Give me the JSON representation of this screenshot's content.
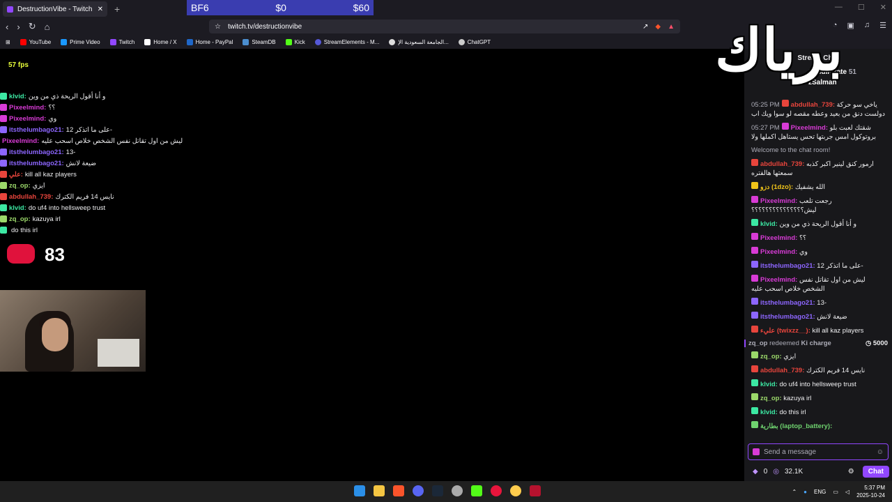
{
  "browser": {
    "tab_title": "DestructionVibe - Twitch",
    "url": "twitch.tv/destructionvibe",
    "bookmarks": [
      "YouTube",
      "Prime Video",
      "Twitch",
      "Home / X",
      "Home - PayPal",
      "SteamDB",
      "Kick",
      "StreamElements - M...",
      "الجامعة السعودية الإ...",
      "ChatGPT"
    ]
  },
  "ad_banner": {
    "title": "BF6",
    "price1": "$0",
    "price2": "$60"
  },
  "stream": {
    "fps": "57",
    "fps_unit": "fps",
    "overlay_title": "برياك",
    "counter": "83"
  },
  "overlay_chat": [
    {
      "name": "klvid",
      "color": "#3ce8a3",
      "text": "و أنا أقول الريحة ذي من وين"
    },
    {
      "name": "Pixeelmind",
      "color": "#d83bd6",
      "text": "؟؟"
    },
    {
      "name": "Pixeelmind",
      "color": "#d83bd6",
      "text": "وي"
    },
    {
      "name": "itsthelumbago21",
      "color": "#8d66ff",
      "text": "على ما اتذكر 12-"
    },
    {
      "name": "Pixeelmind",
      "color": "#d83bd6",
      "text": "ليش من اول تقاتل نفس الشخص خلاص اسحب عليه"
    },
    {
      "name": "itsthelumbago21",
      "color": "#8d66ff",
      "text": "13-"
    },
    {
      "name": "itsthelumbago21",
      "color": "#8d66ff",
      "text": "ضيعة لانش"
    },
    {
      "name": "علي",
      "color": "#e8453c",
      "text": "kill all kaz players"
    },
    {
      "name": "zq_op",
      "color": "#9bd86a",
      "text": "ايزي"
    },
    {
      "name": "abdullah_739",
      "color": "#e8453c",
      "text": "نايس 14 فريم الكترك"
    },
    {
      "name": "klvid",
      "color": "#3ce8a3",
      "text": "do uf4 into hellsweep trust"
    },
    {
      "name": "zq_op",
      "color": "#9bd86a",
      "text": "kazuya irl"
    },
    {
      "name": "",
      "color": "#3ce8a3",
      "text": "do this irl"
    }
  ],
  "chat": {
    "header": "Stream Chat",
    "leaderboard": [
      {
        "name": "SaudiPirate",
        "value": "51"
      },
      {
        "name": "zSalman",
        "value": ""
      }
    ],
    "messages": [
      {
        "time": "05:25 PM",
        "name": "abdullah_739",
        "color": "#e8453c",
        "text": "ياخي سو حركة دولست دنق من بعيد وعطه مقصه لو سوا ويك اب"
      },
      {
        "time": "05:27 PM",
        "name": "Pixeelmind",
        "color": "#d83bd6",
        "text": "شقتك لعبت بلو بروتوكول امس جربتها تحس يستاهل اكملها ولا"
      },
      {
        "system": "Welcome to the chat room!"
      },
      {
        "time": "",
        "name": "abdullah_739",
        "color": "#e8453c",
        "text": "ارمور كنق لينير اكبر كذبه سمعتها هالفتره"
      },
      {
        "time": "",
        "name": "دزو (1dzo)",
        "color": "#f0c419",
        "text": "الله يشفيك"
      },
      {
        "time": "",
        "name": "Pixeelmind",
        "color": "#d83bd6",
        "text": "رجعت تلعب ليش؟؟؟؟؟؟؟؟؟؟؟؟؟؟؟"
      },
      {
        "time": "",
        "name": "klvid",
        "color": "#3ce8a3",
        "text": "و أنا أقول الريحة ذي من وين"
      },
      {
        "time": "",
        "name": "Pixeelmind",
        "color": "#d83bd6",
        "text": "؟؟"
      },
      {
        "time": "",
        "name": "Pixeelmind",
        "color": "#d83bd6",
        "text": "وي"
      },
      {
        "time": "",
        "name": "itsthelumbago21",
        "color": "#8d66ff",
        "text": "على ما اتذكر 12-"
      },
      {
        "time": "",
        "name": "Pixeelmind",
        "color": "#d83bd6",
        "text": "ليش من اول تقاتل نفس الشخص خلاص اسحب عليه"
      },
      {
        "time": "",
        "name": "itsthelumbago21",
        "color": "#8d66ff",
        "text": "13-"
      },
      {
        "time": "",
        "name": "itsthelumbago21",
        "color": "#8d66ff",
        "text": "ضيعة لانش"
      },
      {
        "time": "",
        "name": "عليء (twixzz__)",
        "color": "#e8453c",
        "text": "kill all kaz players"
      }
    ],
    "redeem": {
      "name": "zq_op",
      "action": "redeemed",
      "reward": "Ki charge",
      "cost": "5000"
    },
    "messages2": [
      {
        "name": "zq_op",
        "color": "#9bd86a",
        "text": "ايزي"
      },
      {
        "name": "abdullah_739",
        "color": "#e8453c",
        "text": "نايس 14 فريم الكترك"
      },
      {
        "name": "klvid",
        "color": "#3ce8a3",
        "text": "do uf4 into hellsweep trust"
      },
      {
        "name": "zq_op",
        "color": "#9bd86a",
        "text": "kazuya irl"
      },
      {
        "name": "klvid",
        "color": "#3ce8a3",
        "text": "do this irl"
      },
      {
        "name": "بطارية (laptop_battery)",
        "color": "#6fd36f",
        "text": ""
      }
    ],
    "input_placeholder": "Send a message",
    "bits": "0",
    "points": "32.1K",
    "chat_button": "Chat"
  },
  "taskbar": {
    "language": "ENG",
    "time": "5:37 PM",
    "date": "2025-10-24"
  }
}
